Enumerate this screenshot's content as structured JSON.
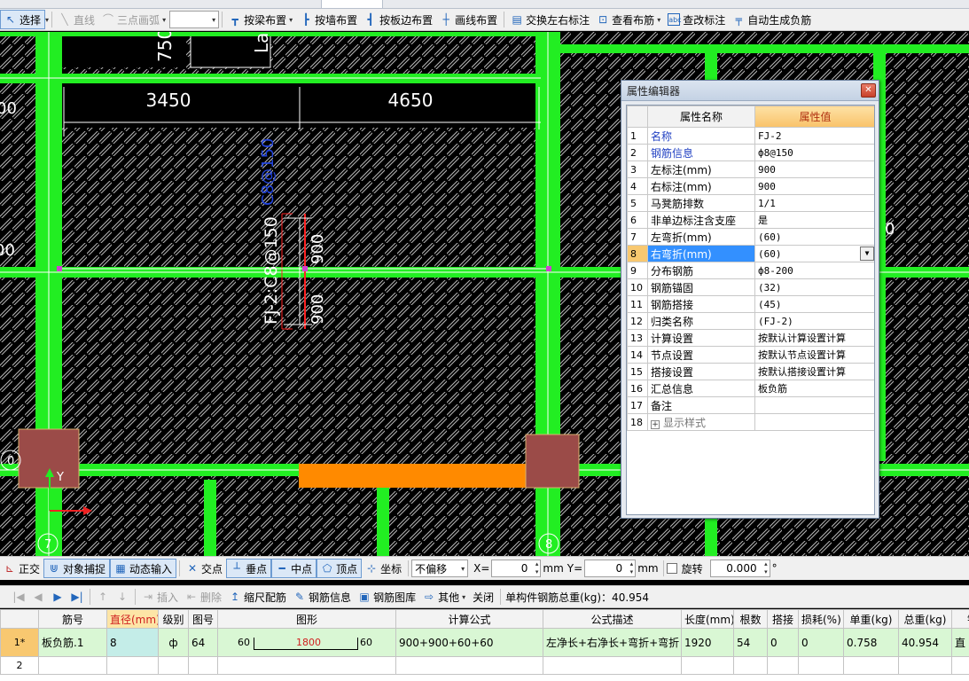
{
  "toolbar_top": {
    "select": "选择",
    "line": "直线",
    "arc": "三点画弧",
    "by_beam": "按梁布置",
    "by_wall": "按墙布置",
    "by_slab_edge": "按板边布置",
    "draw_line": "画线布置",
    "swap_labels": "交换左右标注",
    "view_layout": "查看布筋",
    "edit_label": "查改标注",
    "auto_gen": "自动生成负筋"
  },
  "drawing": {
    "dim_left": "3450",
    "dim_right": "4650",
    "top_text_1": "750",
    "top_text_2": "La",
    "left_edge_1": "00",
    "left_edge_2": "00",
    "right_edge": "0",
    "rebar_label": "FJ-2:C8@150",
    "rebar_spec": "C8@150",
    "dim_upper": "900",
    "dim_lower": "900",
    "axis_left": "7",
    "axis_right": "8",
    "axis_corner": "0",
    "axis_y": "Y"
  },
  "property_editor": {
    "title": "属性编辑器",
    "col_name": "属性名称",
    "col_value": "属性值",
    "rows": [
      {
        "idx": "1",
        "name": "名称",
        "value": "FJ-2"
      },
      {
        "idx": "2",
        "name": "钢筋信息",
        "value": "ф8@150"
      },
      {
        "idx": "3",
        "name": "左标注(mm)",
        "value": "900"
      },
      {
        "idx": "4",
        "name": "右标注(mm)",
        "value": "900"
      },
      {
        "idx": "5",
        "name": "马凳筋排数",
        "value": "1/1"
      },
      {
        "idx": "6",
        "name": "非单边标注含支座",
        "value": "是"
      },
      {
        "idx": "7",
        "name": "左弯折(mm)",
        "value": "(60)"
      },
      {
        "idx": "8",
        "name": "右弯折(mm)",
        "value": "(60)"
      },
      {
        "idx": "9",
        "name": "分布钢筋",
        "value": "ф8-200"
      },
      {
        "idx": "10",
        "name": "钢筋锚固",
        "value": "(32)"
      },
      {
        "idx": "11",
        "name": "钢筋搭接",
        "value": "(45)"
      },
      {
        "idx": "12",
        "name": "归类名称",
        "value": "(FJ-2)"
      },
      {
        "idx": "13",
        "name": "计算设置",
        "value": "按默认计算设置计算"
      },
      {
        "idx": "14",
        "name": "节点设置",
        "value": "按默认节点设置计算"
      },
      {
        "idx": "15",
        "name": "搭接设置",
        "value": "按默认搭接设置计算"
      },
      {
        "idx": "16",
        "name": "汇总信息",
        "value": "板负筋"
      },
      {
        "idx": "17",
        "name": "备注",
        "value": ""
      },
      {
        "idx": "18",
        "name": "显示样式",
        "value": ""
      }
    ]
  },
  "snap_bar": {
    "ortho": "正交",
    "object_snap": "对象捕捉",
    "dynamic_input": "动态输入",
    "intersection": "交点",
    "perpendicular": "垂点",
    "midpoint": "中点",
    "vertex": "顶点",
    "coordinate": "坐标",
    "offset_mode": "不偏移",
    "x_label": "X=",
    "x_value": "0",
    "mm1": "mm",
    "y_label": "Y=",
    "y_value": "0",
    "mm2": "mm",
    "rotate": "旋转",
    "rotate_value": "0.000",
    "degree": "°"
  },
  "rebar_bar": {
    "insert": "插入",
    "delete": "删除",
    "scale_rebar": "缩尺配筋",
    "rebar_info": "钢筋信息",
    "rebar_library": "钢筋图库",
    "other": "其他",
    "close": "关闭",
    "total_weight": "单构件钢筋总重(kg)：40.954"
  },
  "rebar_table": {
    "headers": [
      "筋号",
      "直径(mm)",
      "级别",
      "图号",
      "图形",
      "计算公式",
      "公式描述",
      "长度(mm)",
      "根数",
      "搭接",
      "损耗(%)",
      "单重(kg)",
      "总重(kg)",
      "钢"
    ],
    "row1": {
      "rownum": "1*",
      "name": "板负筋.1",
      "diameter": "8",
      "grade": "ф",
      "shape_no": "64",
      "shape_left": "60",
      "shape_mid": "1800",
      "shape_right": "60",
      "formula": "900+900+60+60",
      "description": "左净长+右净长+弯折+弯折",
      "length": "1920",
      "count": "54",
      "lap": "0",
      "loss": "0",
      "unit_weight": "0.758",
      "total_weight": "40.954",
      "last": "直"
    },
    "row2": {
      "rownum": "2"
    }
  },
  "colors": {
    "green": "#22ee22",
    "orange": "#ff8a00",
    "column": "#9b4b48",
    "blue_text": "#2244dd"
  }
}
